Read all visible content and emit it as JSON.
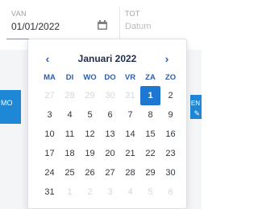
{
  "from_field": {
    "label": "VAN",
    "value": "01/01/2022",
    "icon": "calendar-icon"
  },
  "to_field": {
    "label": "TOT",
    "placeholder": "Datum"
  },
  "background": {
    "left_badge": "MO",
    "right_badge": "EN"
  },
  "calendar": {
    "month_title": "Januari 2022",
    "prev_label": "‹",
    "next_label": "›",
    "weekdays": [
      "MA",
      "DI",
      "WO",
      "DO",
      "VR",
      "ZA",
      "ZO"
    ],
    "accent_color": "#1e78d2",
    "selected_day": 1,
    "days": [
      {
        "label": "27",
        "muted": true
      },
      {
        "label": "28",
        "muted": true
      },
      {
        "label": "29",
        "muted": true
      },
      {
        "label": "30",
        "muted": true
      },
      {
        "label": "31",
        "muted": true
      },
      {
        "label": "1",
        "selected": true
      },
      {
        "label": "2"
      },
      {
        "label": "3"
      },
      {
        "label": "4"
      },
      {
        "label": "5"
      },
      {
        "label": "6"
      },
      {
        "label": "7"
      },
      {
        "label": "8"
      },
      {
        "label": "9"
      },
      {
        "label": "10"
      },
      {
        "label": "11"
      },
      {
        "label": "12"
      },
      {
        "label": "13"
      },
      {
        "label": "14"
      },
      {
        "label": "15"
      },
      {
        "label": "16"
      },
      {
        "label": "17"
      },
      {
        "label": "18"
      },
      {
        "label": "19"
      },
      {
        "label": "20"
      },
      {
        "label": "21"
      },
      {
        "label": "22"
      },
      {
        "label": "23"
      },
      {
        "label": "24"
      },
      {
        "label": "25"
      },
      {
        "label": "26"
      },
      {
        "label": "27"
      },
      {
        "label": "28"
      },
      {
        "label": "29"
      },
      {
        "label": "30"
      },
      {
        "label": "31"
      },
      {
        "label": "1",
        "muted": true
      },
      {
        "label": "2",
        "muted": true
      },
      {
        "label": "3",
        "muted": true
      },
      {
        "label": "4",
        "muted": true
      },
      {
        "label": "5",
        "muted": true
      },
      {
        "label": "6",
        "muted": true
      }
    ]
  }
}
